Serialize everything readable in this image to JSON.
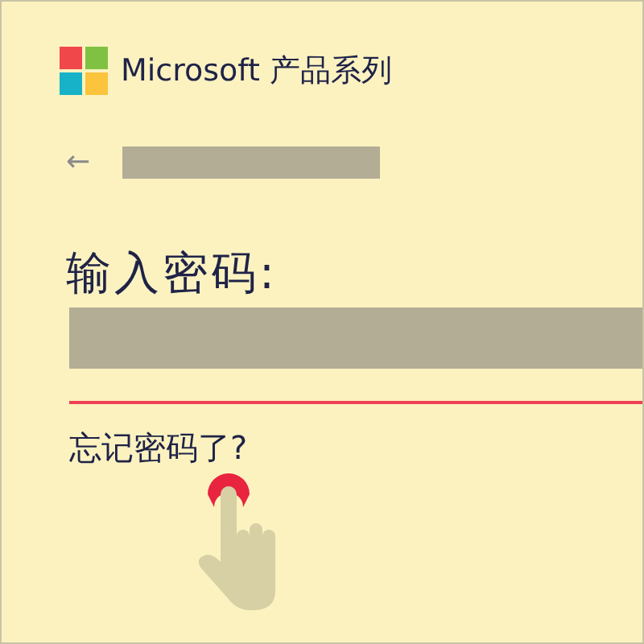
{
  "header": {
    "brand": "Microsoft 产品系列"
  },
  "account": {
    "back": "←"
  },
  "password": {
    "heading": "输入密码:",
    "invalid": true
  },
  "forgot_link": "忘记密码了?"
}
